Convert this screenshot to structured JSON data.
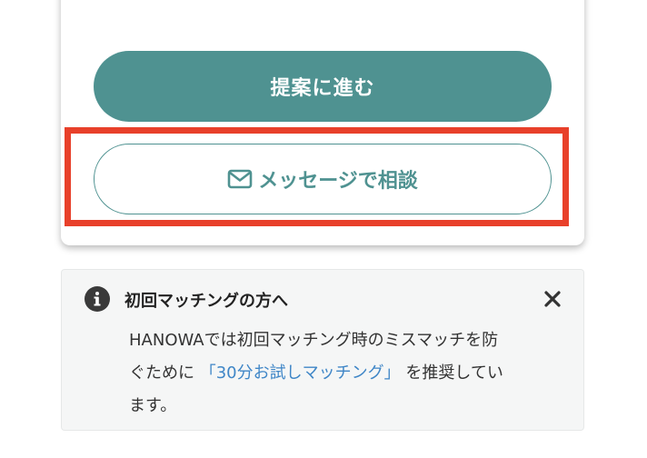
{
  "card": {
    "primary_button_label": "提案に進む",
    "secondary_button_label": "メッセージで相談",
    "secondary_button_icon": "mail-icon"
  },
  "notice": {
    "icon": "info-icon",
    "title": "初回マッチングの方へ",
    "close_icon": "close-icon",
    "body_line1": "HANOWAでは初回マッチング時のミスマッチを防",
    "body_line2_before": "ぐために",
    "body_link": "「30分お試しマッチング」",
    "body_line2_after": "を推奨してい",
    "body_line3": "ます。"
  },
  "colors": {
    "primary": "#4f9291",
    "highlight": "#e8402a",
    "link": "#3f86c7"
  }
}
